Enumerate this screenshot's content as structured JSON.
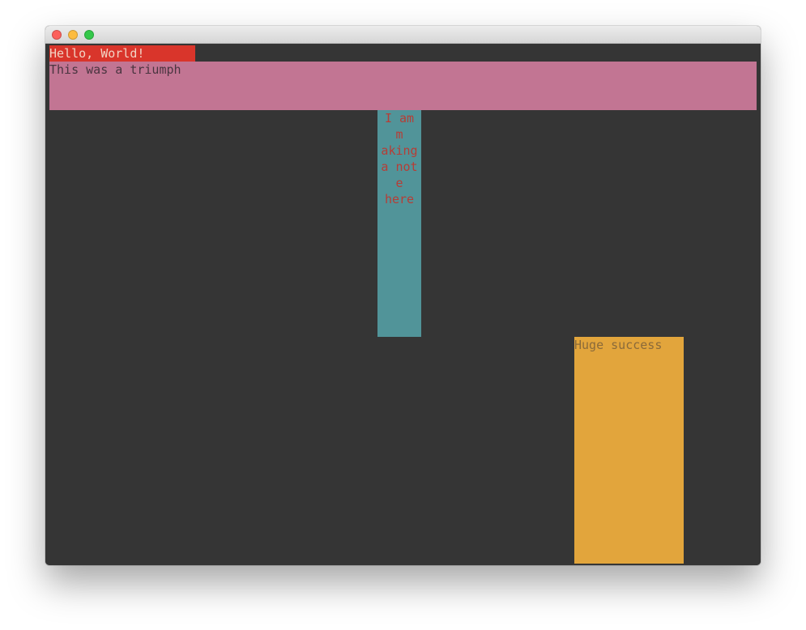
{
  "colors": {
    "background": "#353535",
    "hello_bg": "#d9352b",
    "hello_fg": "#f1d3c4",
    "triumph_bg": "#c27593",
    "triumph_fg": "#4a3540",
    "note_bg": "#519499",
    "note_fg": "#b63d36",
    "success_bg": "#e2a53c",
    "success_fg": "#8a6a3a",
    "close_button": "#fc605b",
    "minimize_button": "#fdbc40",
    "zoom_button": "#34c84a"
  },
  "window": {
    "controls": [
      "close-button",
      "minimize-button",
      "zoom-button"
    ]
  },
  "blocks": {
    "hello": "Hello, World!",
    "triumph": "This was a triumph",
    "note_lines": [
      "I am m",
      "aking",
      "a note",
      "here"
    ],
    "success": "Huge success"
  }
}
